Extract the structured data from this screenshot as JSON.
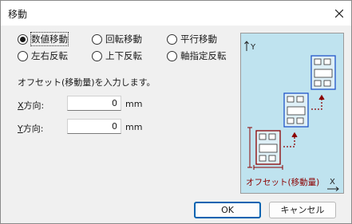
{
  "window": {
    "title": "移動"
  },
  "modes": [
    {
      "label": "数値移動",
      "selected": true
    },
    {
      "label": "回転移動",
      "selected": false
    },
    {
      "label": "平行移動",
      "selected": false
    },
    {
      "label": "左右反転",
      "selected": false
    },
    {
      "label": "上下反転",
      "selected": false
    },
    {
      "label": "軸指定反転",
      "selected": false
    }
  ],
  "instruction": "オフセット(移動量)を入力します。",
  "x_field": {
    "label_key": "X",
    "label_rest": "方向:",
    "value": "0",
    "unit": "mm"
  },
  "y_field": {
    "label_key": "Y",
    "label_rest": "方向:",
    "value": "0",
    "unit": "mm"
  },
  "preview": {
    "axis_y": "Y",
    "axis_x": "X",
    "caption": "オフセット(移動量)",
    "colors": {
      "background": "#bfe3ef",
      "part_outline": "#1f55c9",
      "offset_arrow": "#8b0000"
    }
  },
  "buttons": {
    "ok": "OK",
    "cancel": "キャンセル"
  }
}
